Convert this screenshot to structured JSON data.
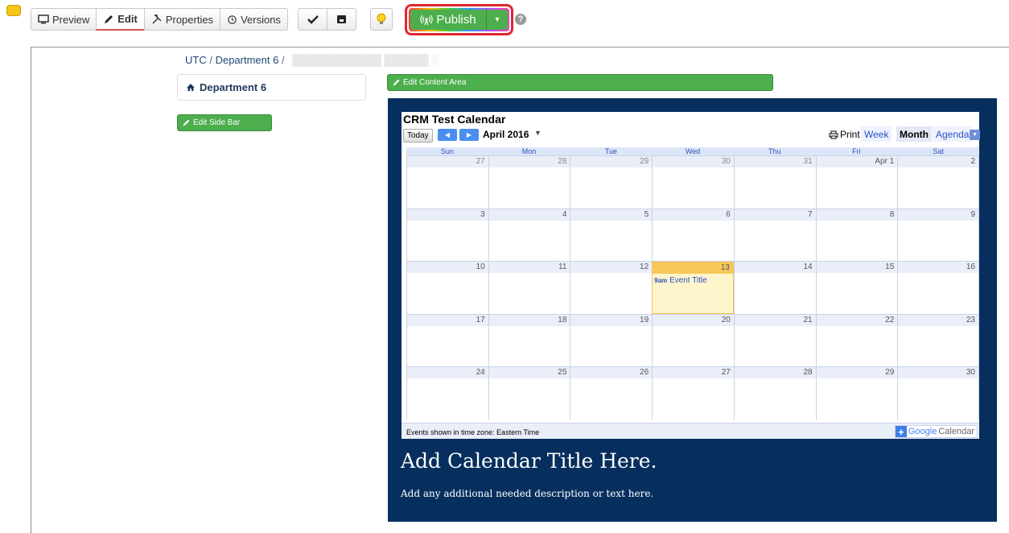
{
  "toolbar": {
    "modes": [
      {
        "label": "Preview",
        "icon": "monitor-icon"
      },
      {
        "label": "Edit",
        "icon": "pencil-icon"
      },
      {
        "label": "Properties",
        "icon": "tools-icon"
      },
      {
        "label": "Versions",
        "icon": "history-icon"
      }
    ],
    "publish_label": "Publish",
    "icons": [
      "folder-icon",
      "check-icon",
      "save-icon",
      "lightbulb-icon",
      "broadcast-icon",
      "help-icon"
    ]
  },
  "breadcrumb": {
    "root": "UTC",
    "section": "Department 6"
  },
  "sidebar": {
    "heading": "Department 6",
    "edit_button": "Edit Side Bar"
  },
  "content": {
    "edit_button": "Edit Content Area",
    "title": "Add Calendar Title Here.",
    "description": "Add any additional needed description or text here."
  },
  "calendar": {
    "title": "CRM Test Calendar",
    "today_label": "Today",
    "month_label": "April 2016",
    "print_label": "Print",
    "views": [
      "Week",
      "Month",
      "Agenda"
    ],
    "active_view": "Month",
    "day_names": [
      "Sun",
      "Mon",
      "Tue",
      "Wed",
      "Thu",
      "Fri",
      "Sat"
    ],
    "weeks": [
      [
        "27",
        "28",
        "29",
        "30",
        "31",
        "Apr 1",
        "2"
      ],
      [
        "3",
        "4",
        "5",
        "6",
        "7",
        "8",
        "9"
      ],
      [
        "10",
        "11",
        "12",
        "13",
        "14",
        "15",
        "16"
      ],
      [
        "17",
        "18",
        "19",
        "20",
        "21",
        "22",
        "23"
      ],
      [
        "24",
        "25",
        "26",
        "27",
        "28",
        "29",
        "30"
      ]
    ],
    "event": {
      "time": "9am",
      "title": "Event Title"
    },
    "footer_tz": "Events shown in time zone: Eastern Time",
    "google_label_g": "Google",
    "google_label_cal": "Calendar"
  },
  "colors": {
    "accent_green": "#4cae4c",
    "panel_navy": "#062f5e",
    "publish_outline": "#e0262b",
    "link_blue": "#2a52be"
  }
}
